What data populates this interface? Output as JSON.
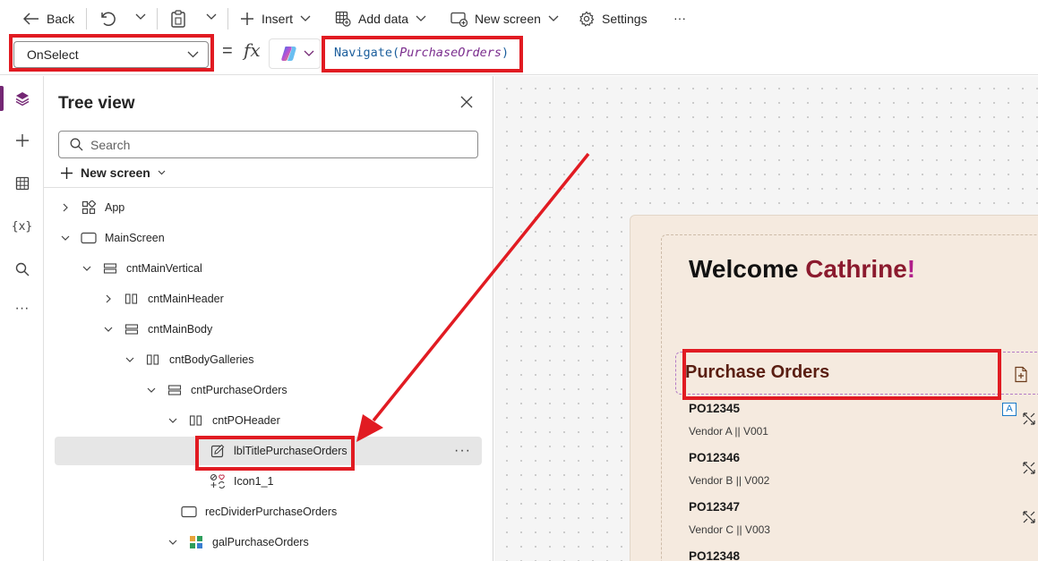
{
  "toolbar": {
    "back_label": "Back",
    "insert_label": "Insert",
    "add_data_label": "Add data",
    "new_screen_label": "New screen",
    "settings_label": "Settings",
    "more_label": "···"
  },
  "formula_bar": {
    "property": "OnSelect",
    "equals": "=",
    "fx": "fx",
    "function_name": "Navigate",
    "open_paren": "(",
    "argument": "PurchaseOrders",
    "close_paren": ")"
  },
  "rail": {
    "items": [
      "layers-icon",
      "plus-icon",
      "table-icon",
      "variables-icon",
      "search-icon",
      "more-icon"
    ],
    "variables_glyph": "{x}",
    "more_glyph": "···"
  },
  "tree": {
    "title": "Tree view",
    "search_placeholder": "Search",
    "new_screen_label": "New screen",
    "nodes": [
      {
        "label": "App",
        "icon": "app-icon"
      },
      {
        "label": "MainScreen",
        "icon": "screen-icon"
      },
      {
        "label": "cntMainVertical",
        "icon": "vertical-container-icon"
      },
      {
        "label": "cntMainHeader",
        "icon": "horizontal-container-icon"
      },
      {
        "label": "cntMainBody",
        "icon": "vertical-container-icon"
      },
      {
        "label": "cntBodyGalleries",
        "icon": "horizontal-container-icon"
      },
      {
        "label": "cntPurchaseOrders",
        "icon": "vertical-container-icon"
      },
      {
        "label": "cntPOHeader",
        "icon": "horizontal-container-icon"
      },
      {
        "label": "lblTitlePurchaseOrders",
        "icon": "label-edit-icon",
        "selected": true
      },
      {
        "label": "Icon1_1",
        "icon": "icon-control-icon"
      },
      {
        "label": "recDividerPurchaseOrders",
        "icon": "rectangle-icon"
      },
      {
        "label": "galPurchaseOrders",
        "icon": "gallery-icon"
      }
    ],
    "more_glyph": "···"
  },
  "canvas": {
    "welcome_prefix": "Welcome ",
    "welcome_name": "Cathrine",
    "welcome_excl": "!",
    "po_title": "Purchase Orders",
    "badge": "A",
    "orders": [
      {
        "id": "PO12345",
        "vendor": "Vendor A || V001"
      },
      {
        "id": "PO12346",
        "vendor": "Vendor B || V002"
      },
      {
        "id": "PO12347",
        "vendor": "Vendor C || V003"
      },
      {
        "id": "PO12348",
        "vendor": ""
      }
    ]
  },
  "colors": {
    "highlight_red": "#e11b22",
    "accent_purple": "#742774",
    "screen_bg": "#f5eadf",
    "title_brown": "#5a1e12"
  }
}
